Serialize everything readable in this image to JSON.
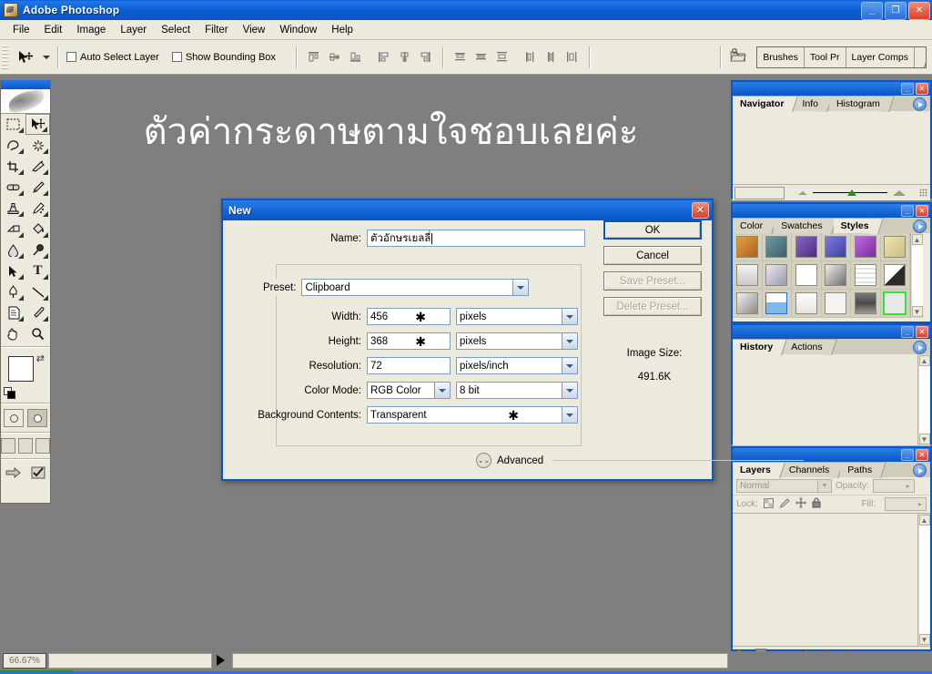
{
  "window": {
    "title": "Adobe Photoshop",
    "app_icon": "photoshop-icon",
    "minimize": "_",
    "restore": "❐",
    "close": "✕"
  },
  "menubar": {
    "items": [
      "File",
      "Edit",
      "Image",
      "Layer",
      "Select",
      "Filter",
      "View",
      "Window",
      "Help"
    ]
  },
  "options_bar": {
    "tool_icon": "move-tool-icon",
    "auto_select_layer": {
      "label": "Auto Select Layer",
      "checked": false
    },
    "show_bounding_box": {
      "label": "Show Bounding Box",
      "checked": false
    },
    "align_buttons": [
      "align-top-edges",
      "align-vertical-centers",
      "align-bottom-edges",
      "align-left-edges",
      "align-horizontal-centers",
      "align-right-edges"
    ],
    "distribute_buttons": [
      "distribute-top-edges",
      "distribute-vertical-centers",
      "distribute-bottom-edges",
      "distribute-left-edges",
      "distribute-horizontal-centers",
      "distribute-right-edges"
    ],
    "file_browser_icon": "file-browser-icon",
    "palette_well": [
      "Brushes",
      "Tool Pr",
      "Layer Comps"
    ]
  },
  "toolbox": {
    "tools": [
      {
        "name": "rectangular-marquee-tool",
        "glyph": "▭",
        "selected": false
      },
      {
        "name": "move-tool",
        "glyph": "➤",
        "selected": true
      },
      {
        "name": "lasso-tool",
        "glyph": "✧",
        "selected": false
      },
      {
        "name": "magic-wand-tool",
        "glyph": "✳",
        "selected": false
      },
      {
        "name": "crop-tool",
        "glyph": "⌗",
        "selected": false
      },
      {
        "name": "slice-tool",
        "glyph": "✂",
        "selected": false
      },
      {
        "name": "healing-brush-tool",
        "glyph": "✒",
        "selected": false
      },
      {
        "name": "brush-tool",
        "glyph": "🖌",
        "selected": false
      },
      {
        "name": "clone-stamp-tool",
        "glyph": "⚲",
        "selected": false
      },
      {
        "name": "history-brush-tool",
        "glyph": "✎",
        "selected": false
      },
      {
        "name": "eraser-tool",
        "glyph": "◳",
        "selected": false
      },
      {
        "name": "paint-bucket-tool",
        "glyph": "⬟",
        "selected": false
      },
      {
        "name": "blur-tool",
        "glyph": "💧",
        "selected": false
      },
      {
        "name": "dodge-tool",
        "glyph": "●",
        "selected": false
      },
      {
        "name": "path-selection-tool",
        "glyph": "➚",
        "selected": false
      },
      {
        "name": "type-tool",
        "glyph": "T",
        "selected": false
      },
      {
        "name": "pen-tool",
        "glyph": "✐",
        "selected": false
      },
      {
        "name": "line-tool",
        "glyph": "╲",
        "selected": false
      },
      {
        "name": "notes-tool",
        "glyph": "🗎",
        "selected": false
      },
      {
        "name": "eyedropper-tool",
        "glyph": "⌇",
        "selected": false
      },
      {
        "name": "hand-tool",
        "glyph": "✋",
        "selected": false
      },
      {
        "name": "zoom-tool",
        "glyph": "🔍",
        "selected": false
      }
    ],
    "foreground_color": "#ffffff",
    "background_color": "#f6c9dd",
    "swap_colors_icon": "swap-colors-icon",
    "default_colors_icon": "default-colors-icon",
    "quick_mask_modes": [
      "standard-mode",
      "quick-mask-mode"
    ],
    "screen_modes": [
      "standard-screen-mode",
      "full-screen-with-menubar",
      "full-screen-mode"
    ],
    "jump_to_imageready": "jump-to-imageready-icon",
    "edit_in_imageready": "edit-in-imageready-icon"
  },
  "canvas": {
    "document_text": "ตัวค่ากระดาษตามใจชอบเลยค่ะ",
    "background_color": "#7f7f7f"
  },
  "status_bar": {
    "zoom": "66.67%",
    "info": "",
    "arrow_icon": "play-arrow-icon"
  },
  "dialog": {
    "title": "New",
    "close_label": "✕",
    "name_label": "Name:",
    "name_value": "ตัวอักษรเยลลี่",
    "preset_label": "Preset:",
    "preset_value": "Clipboard",
    "width_label": "Width:",
    "width_value": "456",
    "width_unit": "pixels",
    "height_label": "Height:",
    "height_value": "368",
    "height_unit": "pixels",
    "resolution_label": "Resolution:",
    "resolution_value": "72",
    "resolution_unit": "pixels/inch",
    "color_mode_label": "Color Mode:",
    "color_mode_value": "RGB Color",
    "color_depth_value": "8 bit",
    "background_contents_label": "Background Contents:",
    "background_contents_value": "Transparent",
    "advanced_label": "Advanced",
    "star_marker": "✱",
    "ok_label": "OK",
    "cancel_label": "Cancel",
    "save_preset_label": "Save Preset...",
    "delete_preset_label": "Delete Preset...",
    "image_size_label": "Image Size:",
    "image_size_value": "491.6K"
  },
  "palettes": {
    "navigator": {
      "tabs": [
        {
          "label": "Navigator",
          "active": true
        },
        {
          "label": "Info",
          "active": false
        },
        {
          "label": "Histogram",
          "active": false
        }
      ],
      "zoom_value": "",
      "zoom_out_icon": "zoom-out-icon",
      "zoom_in_icon": "zoom-in-icon"
    },
    "styles": {
      "tabs": [
        {
          "label": "Color",
          "active": false
        },
        {
          "label": "Swatches",
          "active": false
        },
        {
          "label": "Styles",
          "active": true
        }
      ],
      "swatches": [
        "#c0762f",
        "#4e7d82",
        "#6b4ea0",
        "#5a5ac0",
        "#9b4ec8",
        "#ddd39a",
        "#dcdcdc",
        "#b9b9c4",
        "#ffffff",
        "#9a9a9a",
        "#f0f0f0",
        "#2a2a2a",
        "#c8c8c8",
        "#7fb8e8",
        "#f5f5f5",
        "#ededed",
        "#6e6e6e",
        "#3cdc3c"
      ]
    },
    "history": {
      "tabs": [
        {
          "label": "History",
          "active": true
        },
        {
          "label": "Actions",
          "active": false
        }
      ],
      "footer_buttons": [
        "create-new-document-from-state",
        "create-new-snapshot",
        "delete-state"
      ]
    },
    "layers": {
      "tabs": [
        {
          "label": "Layers",
          "active": true
        },
        {
          "label": "Channels",
          "active": false
        },
        {
          "label": "Paths",
          "active": false
        }
      ],
      "blend_mode": "Normal",
      "opacity_label": "Opacity:",
      "opacity_value": "",
      "lock_label": "Lock:",
      "lock_icons": [
        "lock-transparent-pixels",
        "lock-image-pixels",
        "lock-position",
        "lock-all"
      ],
      "fill_label": "Fill:",
      "fill_value": "",
      "footer_buttons": [
        "add-layer-style",
        "add-layer-mask",
        "create-new-group",
        "create-adjustment-layer",
        "create-new-layer",
        "delete-layer"
      ]
    }
  }
}
